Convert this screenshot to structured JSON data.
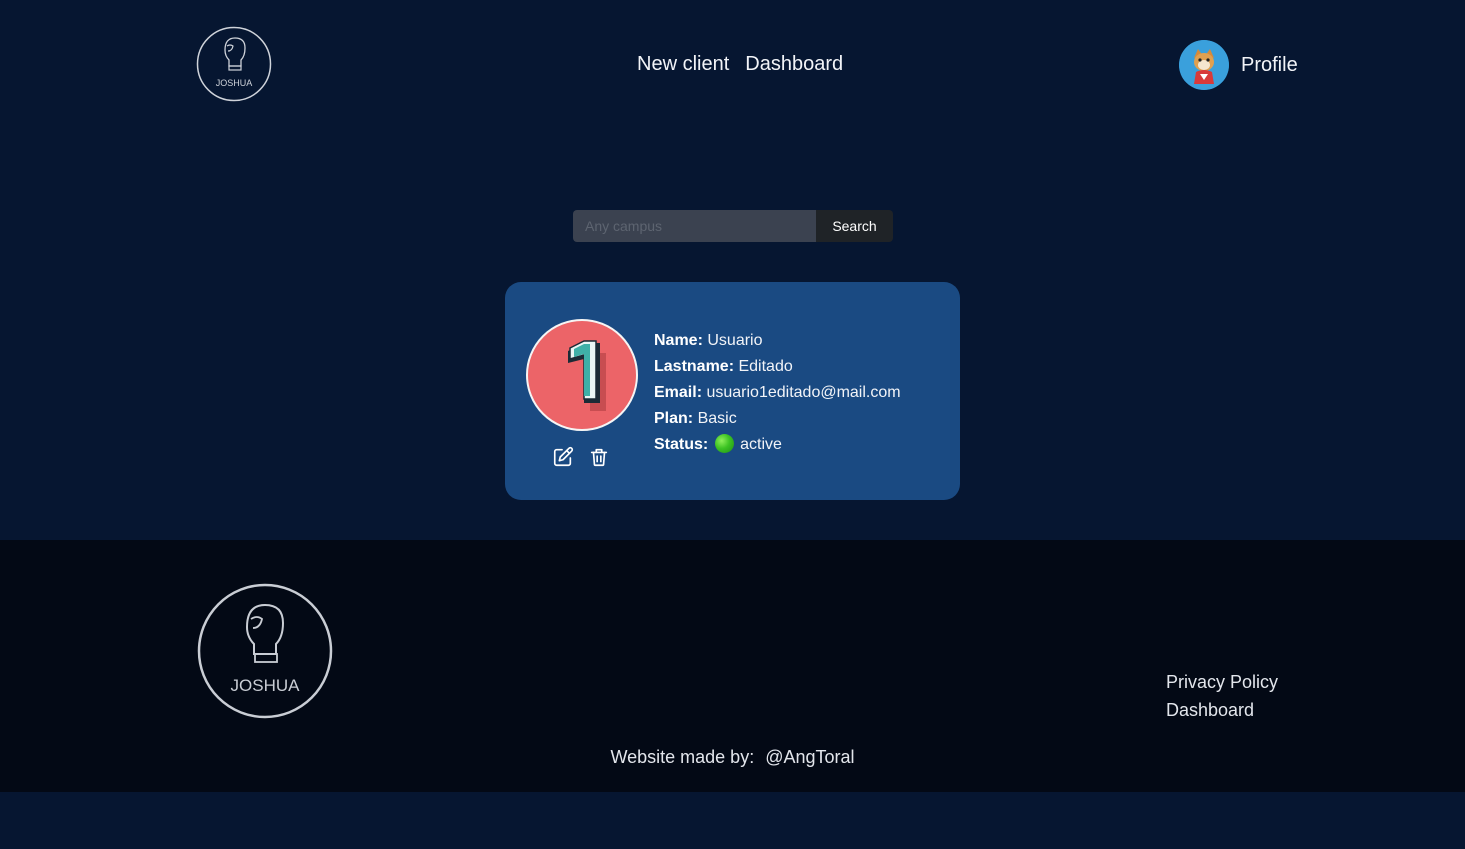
{
  "header": {
    "logo_text": "JOSHUA",
    "nav": [
      {
        "label": "New client"
      },
      {
        "label": "Dashboard"
      }
    ],
    "profile_label": "Profile"
  },
  "search": {
    "placeholder": "Any campus",
    "button_label": "Search"
  },
  "client_card": {
    "avatar_number": "1",
    "fields": [
      {
        "label": "Name:",
        "value": "Usuario"
      },
      {
        "label": "Lastname:",
        "value": "Editado"
      },
      {
        "label": "Email:",
        "value": "usuario1editado@mail.com"
      },
      {
        "label": "Plan:",
        "value": "Basic"
      },
      {
        "label": "Status:",
        "value": "active"
      }
    ],
    "status_color": "#3cc323",
    "card_color": "#1a4a82",
    "avatar_color": "#ec6468",
    "icons": [
      "edit-icon",
      "trash-icon"
    ]
  },
  "footer": {
    "logo_text": "JOSHUA",
    "links": [
      {
        "label": "Privacy Policy"
      },
      {
        "label": "Dashboard"
      }
    ],
    "credit_prefix": "Website made by:",
    "credit_handle": "@AngToral"
  },
  "colors": {
    "page_bg": "#061631",
    "footer_bg": "#030915"
  }
}
